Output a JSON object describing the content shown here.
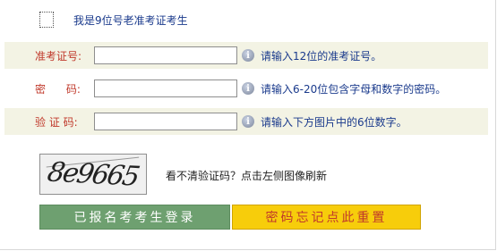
{
  "top": {
    "checkbox_label": "我是9位号老准考证考生"
  },
  "rows": [
    {
      "label": "准考证号:",
      "hint": "请输入12位的准考证号。",
      "value": ""
    },
    {
      "label": "密 码:",
      "hint": "请输入6-20位包含字母和数字的密码。",
      "value": ""
    },
    {
      "label": "验 证 码:",
      "hint": "请输入下方图片中的6位数字。",
      "value": ""
    }
  ],
  "captcha": {
    "image_text": "8e9665",
    "refresh_text": "看不清验证码？点击左侧图像刷新"
  },
  "buttons": {
    "login": "已报名考考生登录",
    "reset": "密码忘记点此重置"
  },
  "icons": {
    "info": "info-icon",
    "checkbox": "checkbox"
  },
  "colors": {
    "login_bg": "#6ea070",
    "reset_bg": "#f7cd0b",
    "label": "#c0392b",
    "hint": "#1a3a8c"
  }
}
